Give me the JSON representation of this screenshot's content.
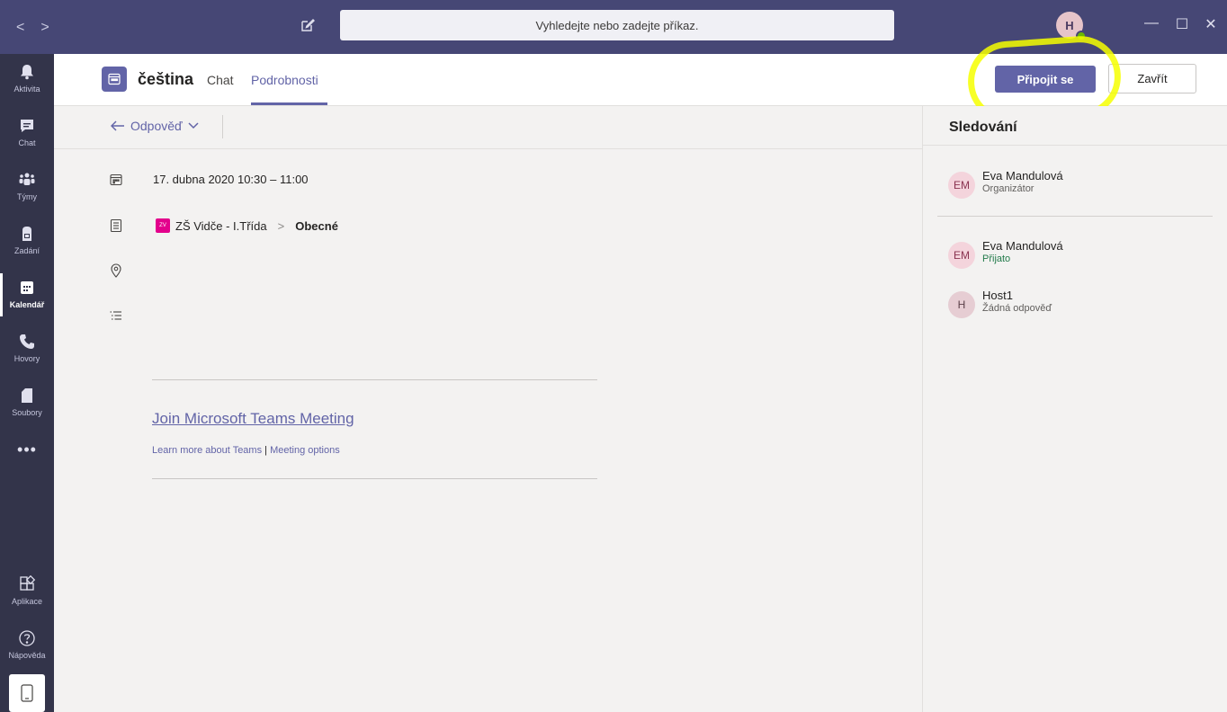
{
  "titlebar": {
    "search_placeholder": "Vyhledejte nebo zadejte příkaz.",
    "avatar_initial": "H",
    "minimize": "—",
    "maximize": "☐",
    "close": "✕"
  },
  "rail": {
    "items": [
      {
        "label": "Aktivita",
        "icon": "bell-icon"
      },
      {
        "label": "Chat",
        "icon": "chat-icon"
      },
      {
        "label": "Týmy",
        "icon": "teams-icon"
      },
      {
        "label": "Zadání",
        "icon": "assignments-icon"
      },
      {
        "label": "Kalendář",
        "icon": "calendar-icon",
        "active": true
      },
      {
        "label": "Hovory",
        "icon": "phone-icon"
      },
      {
        "label": "Soubory",
        "icon": "files-icon"
      }
    ],
    "more": "•••",
    "apps": "Aplikace",
    "help": "Nápověda"
  },
  "header": {
    "title": "čeština",
    "tabs": [
      {
        "label": "Chat"
      },
      {
        "label": "Podrobnosti",
        "active": true
      }
    ],
    "join_button": "Připojit se",
    "close_button": "Zavřít"
  },
  "toolbar": {
    "reply_label": "Odpověď"
  },
  "details": {
    "date": "17. dubna 2020 10:30 – 11:00",
    "channel_badge": "ZV",
    "team": "ZŠ Vidče - I.Třída",
    "channel": "Obecné",
    "join_link": "Join Microsoft Teams Meeting",
    "learn_more": "Learn more about Teams",
    "separator": "|",
    "meeting_options": "Meeting options"
  },
  "panel": {
    "title": "Sledování",
    "organizer": {
      "initials": "EM",
      "name": "Eva Mandulová",
      "role": "Organizátor"
    },
    "attendees": [
      {
        "initials": "EM",
        "name": "Eva Mandulová",
        "status": "Přijato"
      },
      {
        "initials": "H",
        "name": "Host1",
        "status": "Žádná odpověď"
      }
    ]
  },
  "colors": {
    "accent": "#6264a7",
    "titlebar": "#464775",
    "rail": "#33344a",
    "highlight": "#f6ff00",
    "accepted": "#237b4b"
  }
}
